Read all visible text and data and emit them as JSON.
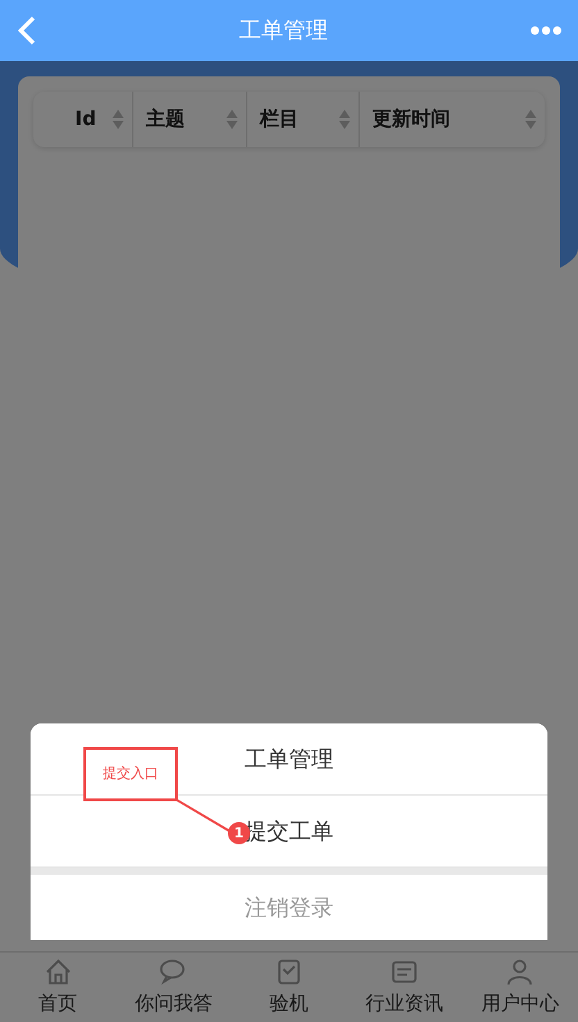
{
  "header": {
    "title": "工单管理"
  },
  "table": {
    "columns": [
      {
        "label": "Id"
      },
      {
        "label": "主题"
      },
      {
        "label": "栏目"
      },
      {
        "label": "更新时间"
      }
    ]
  },
  "action_sheet": {
    "items": [
      {
        "label": "工单管理",
        "kind": "action"
      },
      {
        "label": "提交工单",
        "kind": "action"
      },
      {
        "label": "注销登录",
        "kind": "cancel"
      }
    ]
  },
  "tab_bar": [
    {
      "label": "首页"
    },
    {
      "label": "你问我答"
    },
    {
      "label": "验机"
    },
    {
      "label": "行业资讯"
    },
    {
      "label": "用户中心"
    }
  ],
  "annotation": {
    "label": "提交入口",
    "marker": "1"
  }
}
